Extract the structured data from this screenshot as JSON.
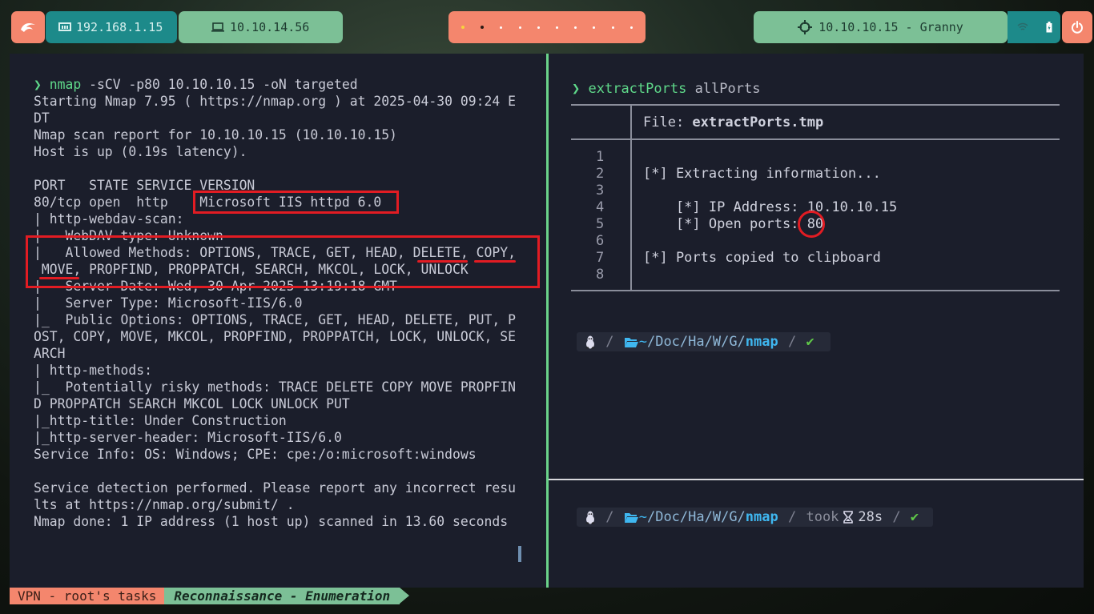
{
  "topbar": {
    "ip_local": "192.168.1.15",
    "ip_vpn": "10.10.14.56",
    "target": "10.10.10.15 - Granny",
    "colors": {
      "coral": "#f4866d",
      "teal": "#1d8a8a",
      "green": "#7cc096"
    }
  },
  "left": {
    "cmd_prefix": "❯",
    "cmd_name": "nmap",
    "cmd_args": " -sCV -p80 10.10.10.15 -oN targeted",
    "lines": [
      "Starting Nmap 7.95 ( https://nmap.org ) at 2025-04-30 09:24 E",
      "DT",
      "Nmap scan report for 10.10.10.15 (10.10.10.15)",
      "Host is up (0.19s latency).",
      "",
      "PORT   STATE SERVICE VERSION",
      "80/tcp open  http    Microsoft IIS httpd 6.0",
      "| http-webdav-scan:",
      "|   WebDAV type: Unknown",
      "|   Allowed Methods: OPTIONS, TRACE, GET, HEAD, DELETE, COPY,",
      " MOVE, PROPFIND, PROPPATCH, SEARCH, MKCOL, LOCK, UNLOCK",
      "|   Server Date: Wed, 30 Apr 2025 13:19:18 GMT",
      "|   Server Type: Microsoft-IIS/6.0",
      "|_  Public Options: OPTIONS, TRACE, GET, HEAD, DELETE, PUT, P",
      "OST, COPY, MOVE, MKCOL, PROPFIND, PROPPATCH, LOCK, UNLOCK, SE",
      "ARCH",
      "| http-methods:",
      "|_  Potentially risky methods: TRACE DELETE COPY MOVE PROPFIN",
      "D PROPPATCH SEARCH MKCOL LOCK UNLOCK PUT",
      "|_http-title: Under Construction",
      "|_http-server-header: Microsoft-IIS/6.0",
      "Service Info: OS: Windows; CPE: cpe:/o:microsoft:windows",
      "",
      "Service detection performed. Please report any incorrect resu",
      "lts at https://nmap.org/submit/ .",
      "Nmap done: 1 IP address (1 host up) scanned in 13.60 seconds"
    ]
  },
  "right": {
    "cmd_prefix": "❯",
    "cmd_name": "extractPorts",
    "cmd_args": " allPorts",
    "file_label": "File: ",
    "file_name": "extractPorts.tmp",
    "line_numbers": [
      "1",
      "2",
      "3",
      "4",
      "5",
      "6",
      "7",
      "8"
    ],
    "content": [
      "",
      "[*] Extracting information...",
      "",
      "    [*] IP Address: 10.10.10.15",
      "    [*] Open ports: 80",
      "",
      "[*] Ports copied to clipboard",
      ""
    ],
    "prompt1": {
      "tilde": "~",
      "path": "/Doc/Ha/W/G/",
      "dir": "nmap",
      "check": "✔"
    },
    "prompt2": {
      "tilde": "~",
      "path": "/Doc/Ha/W/G/",
      "dir": "nmap",
      "took": "took",
      "time": "28s",
      "check": "✔"
    }
  },
  "status": {
    "session": "VPN - root's tasks",
    "window": "Reconnaissance - Enumeration"
  }
}
